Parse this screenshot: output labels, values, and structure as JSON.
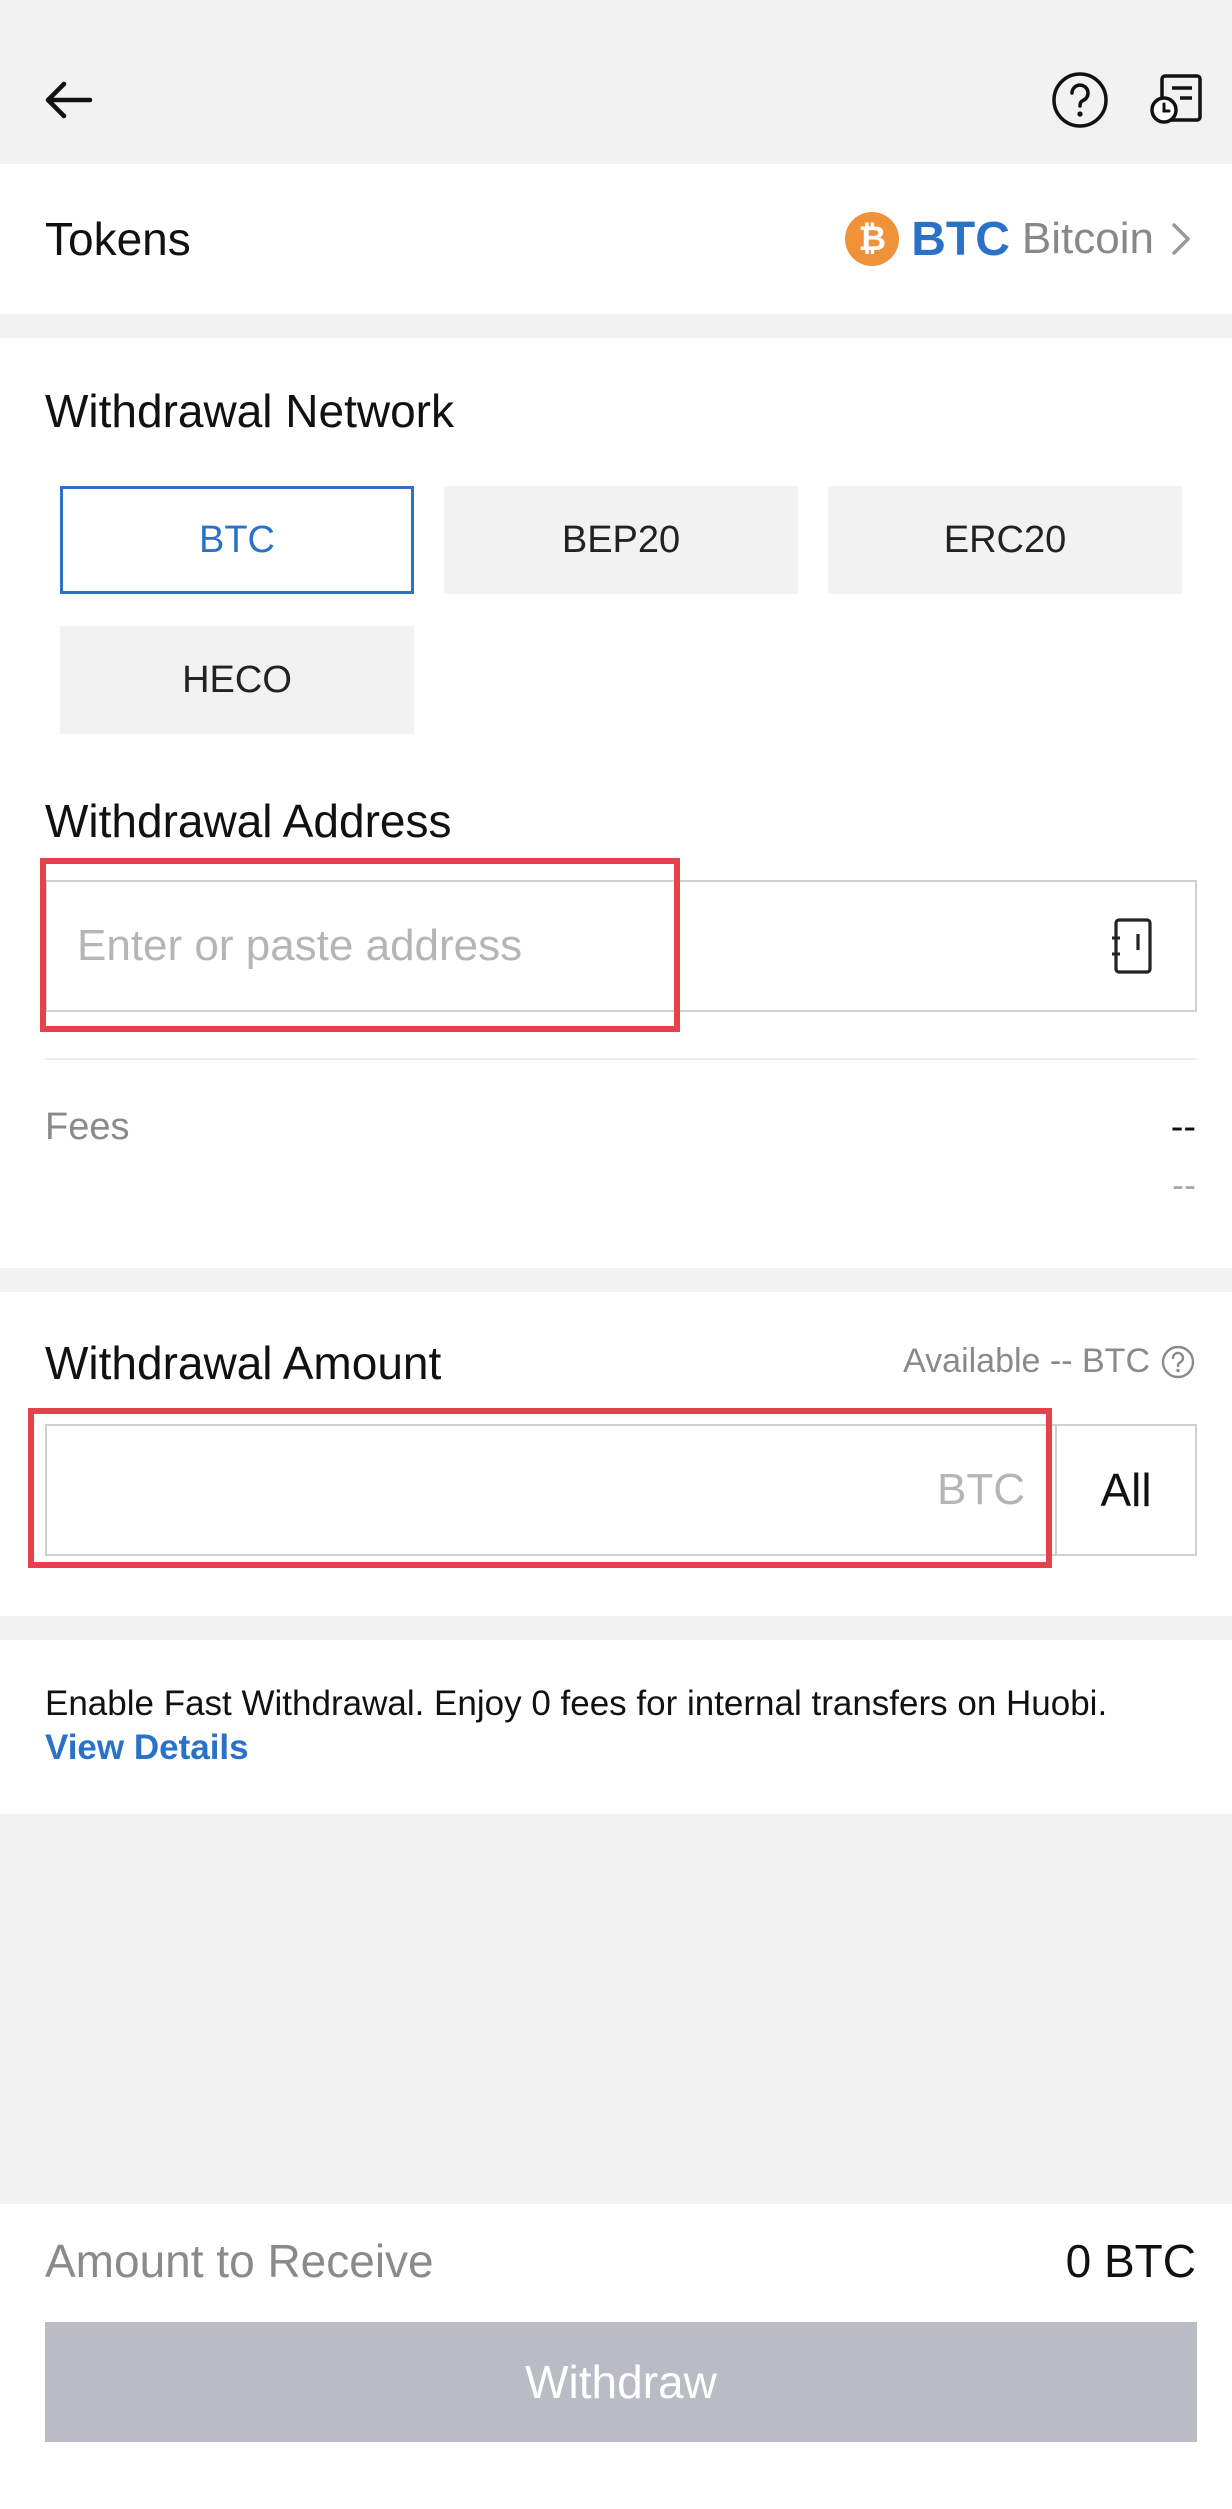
{
  "header": {
    "back_icon": "arrow-left-icon",
    "help_icon": "question-circle-icon",
    "records_icon": "history-records-icon"
  },
  "tokens": {
    "label": "Tokens",
    "coin_icon": "bitcoin-icon",
    "coin_glyph": "₿",
    "symbol": "BTC",
    "name": "Bitcoin",
    "accent_color": "#f0923a"
  },
  "network": {
    "title": "Withdrawal Network",
    "options": [
      "BTC",
      "BEP20",
      "ERC20",
      "HECO"
    ],
    "selected": "BTC"
  },
  "address": {
    "title": "Withdrawal Address",
    "placeholder": "Enter or paste address",
    "value": "",
    "book_icon": "address-book-icon"
  },
  "fees": {
    "label": "Fees",
    "value_primary": "--",
    "value_secondary": "--"
  },
  "amount": {
    "title": "Withdrawal Amount",
    "available_text": "Available -- BTC",
    "unit": "BTC",
    "value": "",
    "all_label": "All"
  },
  "notice": {
    "text": "Enable Fast Withdrawal. Enjoy 0 fees for internal transfers on Huobi.",
    "link": "View Details"
  },
  "footer": {
    "receive_label": "Amount to Receive",
    "receive_value": "0 BTC",
    "withdraw_label": "Withdraw"
  },
  "colors": {
    "accent": "#2a72c8",
    "highlight": "#e5424d",
    "disabled_button": "#b9bcc5"
  }
}
